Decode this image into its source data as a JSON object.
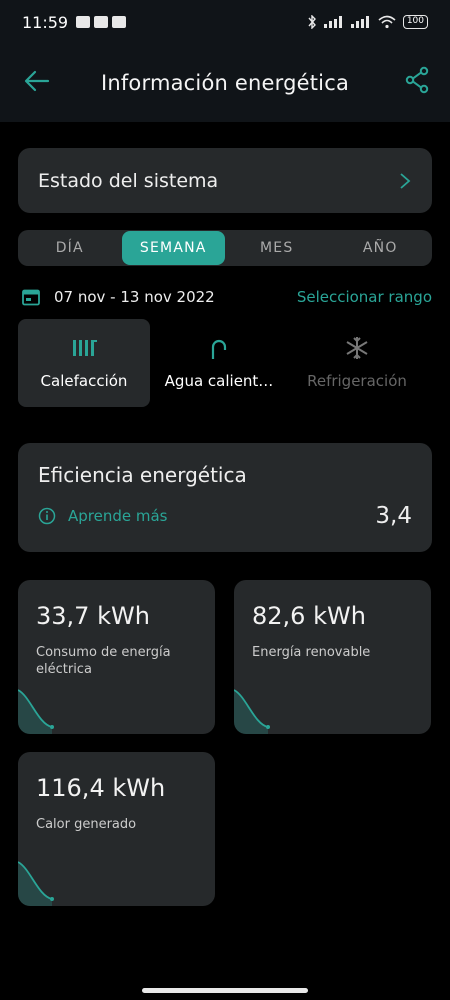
{
  "status": {
    "time": "11:59",
    "battery": "100"
  },
  "header": {
    "title": "Información energética"
  },
  "system": {
    "label": "Estado del sistema"
  },
  "period_tabs": [
    {
      "label": "DÍA"
    },
    {
      "label": "SEMANA"
    },
    {
      "label": "MES"
    },
    {
      "label": "AÑO"
    }
  ],
  "date": {
    "range": "07 nov - 13 nov 2022",
    "select_range": "Seleccionar rango"
  },
  "services": [
    {
      "label": "Calefacción",
      "icon": "radiator-icon"
    },
    {
      "label": "Agua calient…",
      "icon": "faucet-icon"
    },
    {
      "label": "Refrigeración",
      "icon": "snowflake-icon"
    }
  ],
  "efficiency": {
    "title": "Eficiencia energética",
    "learn_more": "Aprende más",
    "value": "3,4"
  },
  "stats": [
    {
      "value": "33,7 kWh",
      "label": "Consumo de energía eléctrica"
    },
    {
      "value": "82,6 kWh",
      "label": "Energía renovable"
    },
    {
      "value": "116,4 kWh",
      "label": "Calor generado"
    }
  ],
  "colors": {
    "accent": "#2aa597",
    "card": "#26292b",
    "background": "#000000",
    "header": "#101418"
  }
}
